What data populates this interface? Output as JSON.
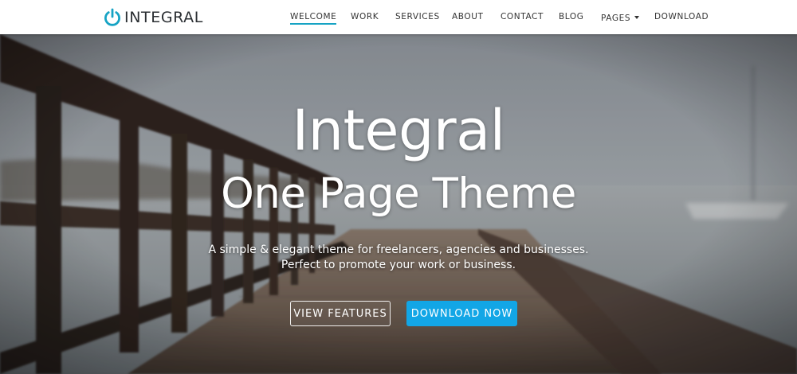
{
  "brand": {
    "name": "INTEGRAL",
    "icon": "power-icon",
    "accent": "#16a3c4"
  },
  "nav": {
    "items": [
      {
        "label": "WELCOME",
        "active": true
      },
      {
        "label": "WORK"
      },
      {
        "label": "SERVICES"
      },
      {
        "label": "ABOUT"
      },
      {
        "label": "CONTACT"
      },
      {
        "label": "BLOG"
      },
      {
        "label": "PAGES",
        "dropdown": true
      },
      {
        "label": "DOWNLOAD"
      }
    ]
  },
  "hero": {
    "title_line1": "Integral",
    "title_line2": "One Page Theme",
    "subtitle_line1": "A simple & elegant theme for freelancers, agencies and businesses.",
    "subtitle_line2": "Perfect to promote your work or business.",
    "buttons": {
      "secondary": "VIEW FEATURES",
      "primary": "DOWNLOAD NOW"
    },
    "primary_color": "#12a6e6"
  }
}
